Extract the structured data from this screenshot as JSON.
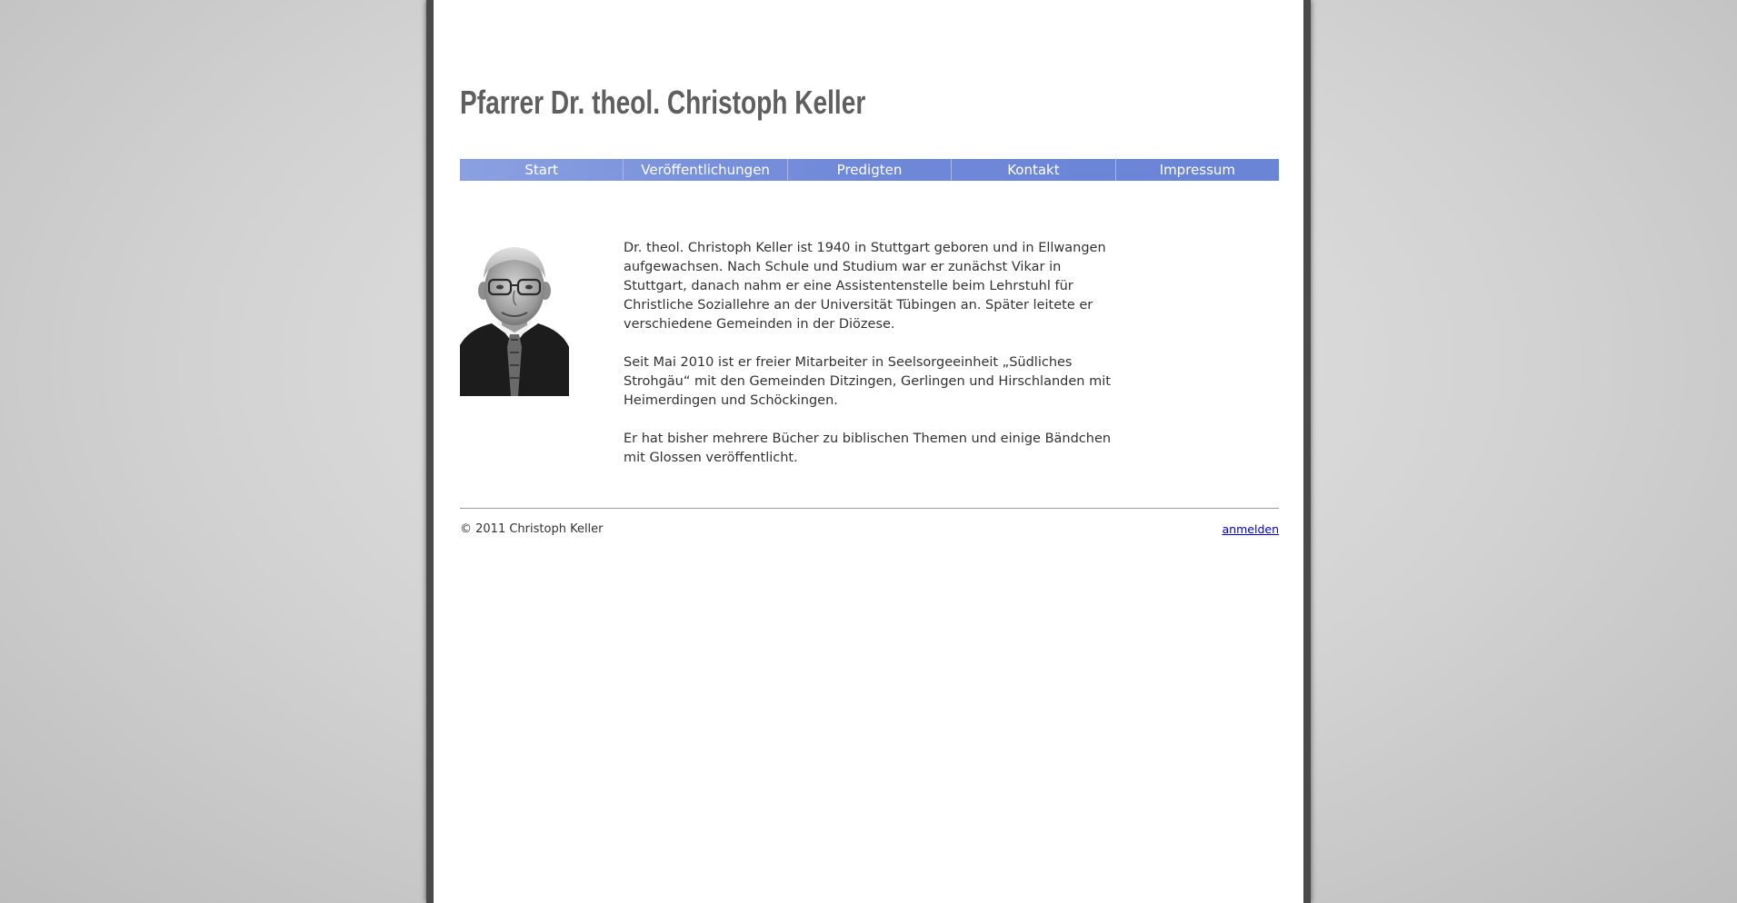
{
  "header": {
    "title": "Pfarrer Dr. theol. Christoph Keller"
  },
  "nav": {
    "items": [
      {
        "label": "Start"
      },
      {
        "label": "Veröffentlichungen"
      },
      {
        "label": "Predigten"
      },
      {
        "label": "Kontakt"
      },
      {
        "label": "Impressum"
      }
    ]
  },
  "main": {
    "portrait_icon": "portrait-photo",
    "paragraphs": [
      "Dr. theol. Christoph Keller ist 1940 in Stuttgart geboren und in Ellwangen aufgewachsen. Nach Schule und Studium war er zunächst Vikar in Stuttgart, danach nahm er eine Assistentenstelle beim Lehrstuhl für Christliche Soziallehre an der Universität Tübingen an. Später leitete er verschiedene Gemeinden in der Diözese.",
      "Seit Mai 2010 ist er freier Mitarbeiter in Seelsorgeeinheit „Südliches Strohgäu“ mit den Gemeinden Ditzingen, Gerlingen und Hirschlanden mit Heimerdingen und Schöckingen.",
      "Er hat bisher mehrere Bücher zu biblischen Themen und einige Bändchen mit Glossen veröffentlicht."
    ]
  },
  "footer": {
    "copyright": "© 2011 Christoph Keller",
    "login_label": "anmelden"
  },
  "colors": {
    "nav_background": "#6f88d8",
    "title_text": "#5f5f5f",
    "link": "#0000cc"
  }
}
